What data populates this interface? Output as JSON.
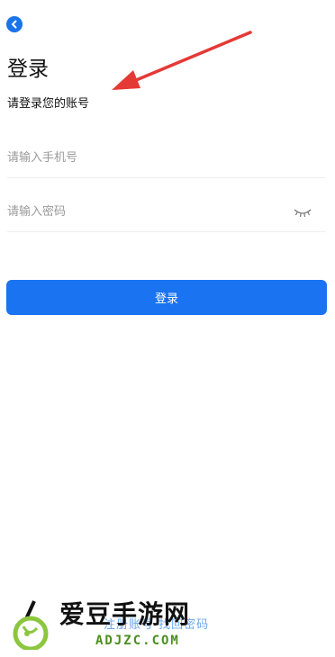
{
  "header": {
    "back_icon": "chevron-left-icon"
  },
  "page": {
    "title": "登录",
    "subtitle": "请登录您的账号"
  },
  "form": {
    "phone_placeholder": "请输入手机号",
    "password_placeholder": "请输入密码",
    "password_toggle_icon": "eye-closed-icon",
    "login_label": "登录"
  },
  "footer": {
    "link_label": "注册账号 找回密码"
  },
  "watermark": {
    "name": "爱豆手游网",
    "domain": "ADJZC.COM"
  },
  "colors": {
    "accent": "#1a73f0",
    "annotation": "#e53935",
    "watermark_green": "#4a8f1f"
  }
}
